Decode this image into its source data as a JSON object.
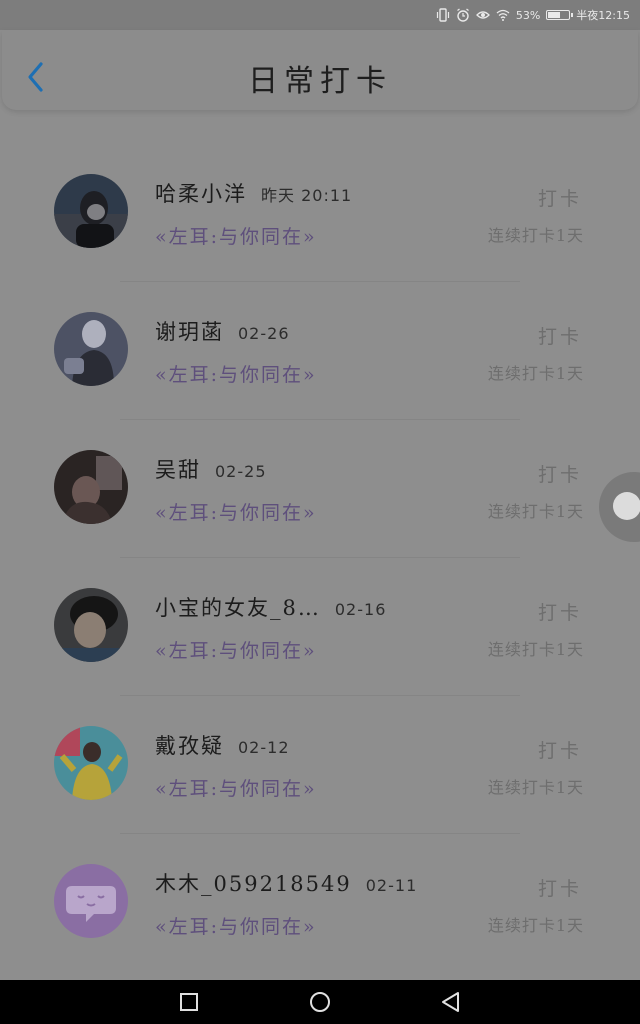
{
  "status_bar": {
    "battery_percent": "53%",
    "time": "半夜12:15",
    "icons": [
      "vibrate-icon",
      "alarm-icon",
      "eye-icon",
      "wifi-icon",
      "battery-icon"
    ]
  },
  "header": {
    "title": "日常打卡",
    "back_icon": "chevron-left-icon",
    "accent_color": "#1e6fb3"
  },
  "list": [
    {
      "name": "哈柔小洋",
      "date": "昨天 20:11",
      "tagline": "«左耳:与你同在»",
      "action": "打卡",
      "streak": "连续打卡1天",
      "avatar": "photo-dark-portrait"
    },
    {
      "name": "谢玥菡",
      "date": "02-26",
      "tagline": "«左耳:与你同在»",
      "action": "打卡",
      "streak": "连续打卡1天",
      "avatar": "photo-girl-sitting"
    },
    {
      "name": "吴甜",
      "date": "02-25",
      "tagline": "«左耳:与你同在»",
      "action": "打卡",
      "streak": "连续打卡1天",
      "avatar": "photo-night-scene"
    },
    {
      "name": "小宝的女友_8…",
      "date": "02-16",
      "tagline": "«左耳:与你同在»",
      "action": "打卡",
      "streak": "连续打卡1天",
      "avatar": "photo-boy-portrait"
    },
    {
      "name": "戴孜疑",
      "date": "02-12",
      "tagline": "«左耳:与你同在»",
      "action": "打卡",
      "streak": "连续打卡1天",
      "avatar": "photo-yellow-shirt"
    },
    {
      "name": "木木_059218549",
      "date": "02-11",
      "tagline": "«左耳:与你同在»",
      "action": "打卡",
      "streak": "连续打卡1天",
      "avatar": "chat-bubble-avatar"
    }
  ],
  "nav_bar": {
    "icons": [
      "square-recents-icon",
      "circle-home-icon",
      "triangle-back-icon"
    ]
  }
}
